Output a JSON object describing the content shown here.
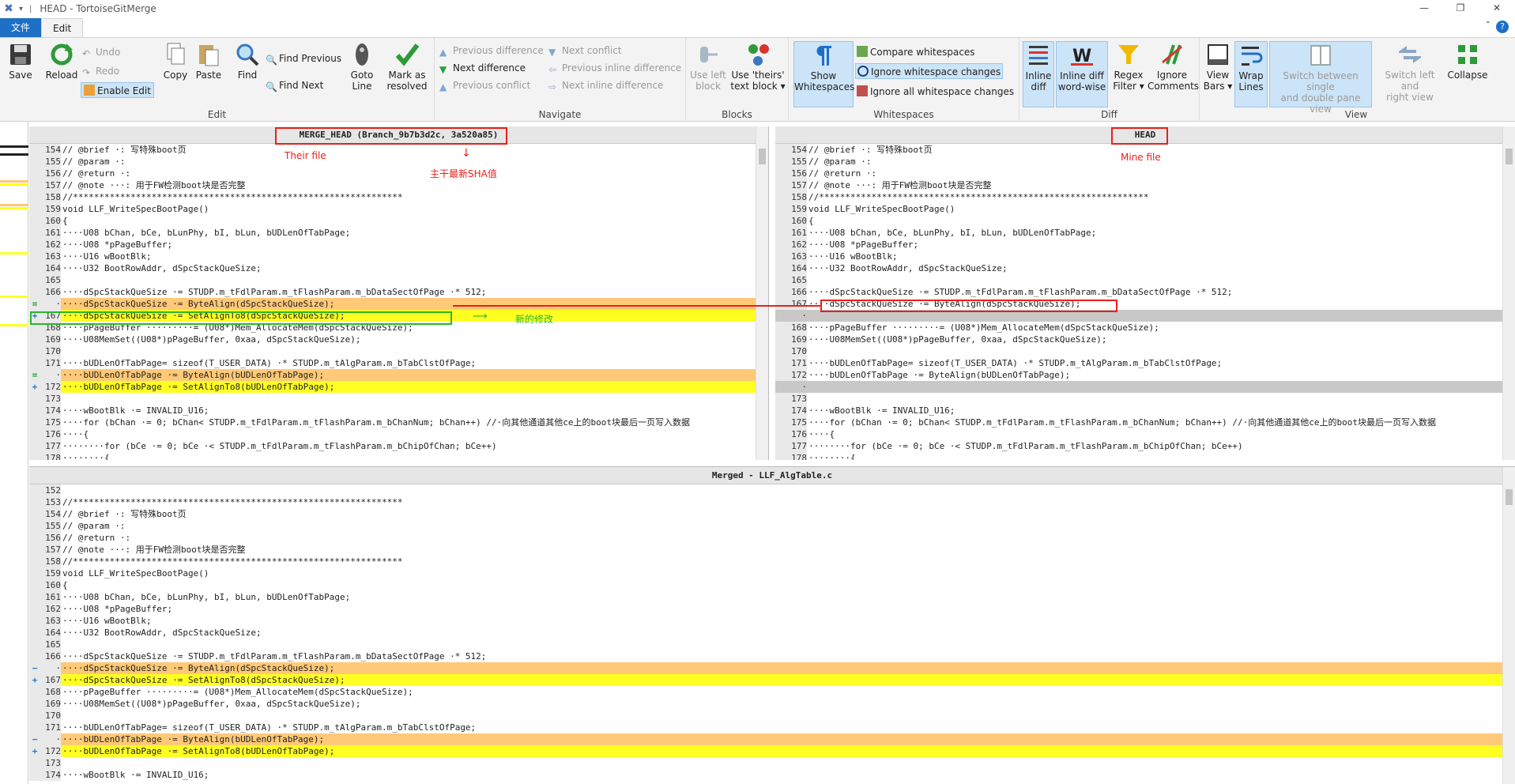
{
  "window": {
    "title": "HEAD - TortoiseGitMerge",
    "min": "—",
    "max": "❐",
    "close": "✕"
  },
  "ribbon_tabs": {
    "file": "文件",
    "edit": "Edit"
  },
  "ribbon": {
    "edit_group": {
      "label": "Edit",
      "save": "Save",
      "reload": "Reload",
      "undo": "Undo",
      "redo": "Redo",
      "enable_edit": "Enable Edit",
      "copy": "Copy",
      "paste": "Paste",
      "find": "Find",
      "find_previous": "Find Previous",
      "find_next": "Find Next",
      "goto_line_1": "Goto",
      "goto_line_2": "Line",
      "mark_resolved_1": "Mark as",
      "mark_resolved_2": "resolved"
    },
    "navigate_group": {
      "label": "Navigate",
      "prev_diff": "Previous difference",
      "next_diff": "Next difference",
      "prev_conflict": "Previous conflict",
      "next_conflict": "Next conflict",
      "prev_inline": "Previous inline difference",
      "next_inline": "Next inline difference"
    },
    "blocks_group": {
      "label": "Blocks",
      "use_left_1": "Use left",
      "use_left_2": "block",
      "use_theirs_1": "Use 'theirs'",
      "use_theirs_2": "text block"
    },
    "whitespaces_group": {
      "label": "Whitespaces",
      "show_ws_1": "Show",
      "show_ws_2": "Whitespaces",
      "compare_ws": "Compare whitespaces",
      "ignore_ws_changes": "Ignore whitespace changes",
      "ignore_all_ws": "Ignore all whitespace changes"
    },
    "diff_group": {
      "label": "Diff",
      "inline_diff_1": "Inline",
      "inline_diff_2": "diff",
      "inline_word_1": "Inline diff",
      "inline_word_2": "word-wise",
      "regex_1": "Regex",
      "regex_2": "Filter",
      "ignore_comments_1": "Ignore",
      "ignore_comments_2": "Comments"
    },
    "view_group": {
      "label": "View",
      "view_bars_1": "View",
      "view_bars_2": "Bars",
      "wrap_1": "Wrap",
      "wrap_2": "Lines",
      "switch_pane_1": "Switch between single",
      "switch_pane_2": "and double pane view",
      "switch_lr_1": "Switch left and",
      "switch_lr_2": "right view",
      "collapse": "Collapse"
    }
  },
  "left_pane": {
    "header": "MERGE_HEAD (Branch_9b7b3d2c, 3a520a85)",
    "lines": [
      {
        "n": "154",
        "t": "// @brief ·: 写特殊boot页",
        "k": ""
      },
      {
        "n": "155",
        "t": "// @param ·:",
        "k": ""
      },
      {
        "n": "156",
        "t": "// @return ·:",
        "k": ""
      },
      {
        "n": "157",
        "t": "// @note ···: 用于FW检测boot块是否完整",
        "k": ""
      },
      {
        "n": "158",
        "t": "//***************************************************************",
        "k": ""
      },
      {
        "n": "159",
        "t": "void LLF_WriteSpecBootPage()",
        "k": ""
      },
      {
        "n": "160",
        "t": "{",
        "k": ""
      },
      {
        "n": "161",
        "t": "····U08 bChan, bCe, bLunPhy, bI, bLun, bUDLenOfTabPage;",
        "k": ""
      },
      {
        "n": "162",
        "t": "····U08 *pPageBuffer;",
        "k": ""
      },
      {
        "n": "163",
        "t": "····U16 wBootBlk;",
        "k": ""
      },
      {
        "n": "164",
        "t": "····U32 BootRowAddr, dSpcStackQueSize;",
        "k": ""
      },
      {
        "n": "165",
        "t": "",
        "k": ""
      },
      {
        "n": "166",
        "t": "····dSpcStackQueSize ·= STUDP.m_tFdlParam.m_tFlashParam.m_bDataSectOfPage ·* 512;",
        "k": ""
      },
      {
        "n": "·",
        "t": "····dSpcStackQueSize ·= ByteAlign(dSpcStackQueSize);",
        "k": "orange",
        "m": "="
      },
      {
        "n": "167",
        "t": "····dSpcStackQueSize ·= SetAlignTo8(dSpcStackQueSize);",
        "k": "yellow",
        "m": "+"
      },
      {
        "n": "168",
        "t": "····pPageBuffer ·········= (U08*)Mem_AllocateMem(dSpcStackQueSize);",
        "k": ""
      },
      {
        "n": "169",
        "t": "····U08MemSet((U08*)pPageBuffer, 0xaa, dSpcStackQueSize);",
        "k": ""
      },
      {
        "n": "170",
        "t": "",
        "k": ""
      },
      {
        "n": "171",
        "t": "····bUDLenOfTabPage= sizeof(T_USER_DATA) ·* STUDP.m_tAlgParam.m_bTabClstOfPage;",
        "k": ""
      },
      {
        "n": "·",
        "t": "····bUDLenOfTabPage ·= ByteAlign(bUDLenOfTabPage);",
        "k": "orange",
        "m": "="
      },
      {
        "n": "172",
        "t": "····bUDLenOfTabPage ·= SetAlignTo8(bUDLenOfTabPage);",
        "k": "yellow",
        "m": "+"
      },
      {
        "n": "173",
        "t": "",
        "k": ""
      },
      {
        "n": "174",
        "t": "····wBootBlk ·= INVALID_U16;",
        "k": ""
      },
      {
        "n": "175",
        "t": "····for (bChan ·= 0; bChan< STUDP.m_tFdlParam.m_tFlashParam.m_bChanNum; bChan++) //·向其他通道其他ce上的boot块最后一页写入数据",
        "k": ""
      },
      {
        "n": "176",
        "t": "····{",
        "k": ""
      },
      {
        "n": "177",
        "t": "········for (bCe ·= 0; bCe ·< STUDP.m_tFdlParam.m_tFlashParam.m_bChipOfChan; bCe++)",
        "k": ""
      },
      {
        "n": "178",
        "t": "········{",
        "k": ""
      }
    ]
  },
  "right_pane": {
    "header": "HEAD",
    "lines": [
      {
        "n": "154",
        "t": "// @brief ·: 写特殊boot页",
        "k": ""
      },
      {
        "n": "155",
        "t": "// @param ·:",
        "k": ""
      },
      {
        "n": "156",
        "t": "// @return ·:",
        "k": ""
      },
      {
        "n": "157",
        "t": "// @note ···: 用于FW检测boot块是否完整",
        "k": ""
      },
      {
        "n": "158",
        "t": "//***************************************************************",
        "k": ""
      },
      {
        "n": "159",
        "t": "void LLF_WriteSpecBootPage()",
        "k": ""
      },
      {
        "n": "160",
        "t": "{",
        "k": ""
      },
      {
        "n": "161",
        "t": "····U08 bChan, bCe, bLunPhy, bI, bLun, bUDLenOfTabPage;",
        "k": ""
      },
      {
        "n": "162",
        "t": "····U08 *pPageBuffer;",
        "k": ""
      },
      {
        "n": "163",
        "t": "····U16 wBootBlk;",
        "k": ""
      },
      {
        "n": "164",
        "t": "····U32 BootRowAddr, dSpcStackQueSize;",
        "k": ""
      },
      {
        "n": "165",
        "t": "",
        "k": ""
      },
      {
        "n": "166",
        "t": "····dSpcStackQueSize ·= STUDP.m_tFdlParam.m_tFlashParam.m_bDataSectOfPage ·* 512;",
        "k": ""
      },
      {
        "n": "167",
        "t": "····dSpcStackQueSize ·= ByteAlign(dSpcStackQueSize);",
        "k": ""
      },
      {
        "n": "·",
        "t": "",
        "k": "gray"
      },
      {
        "n": "168",
        "t": "····pPageBuffer ·········= (U08*)Mem_AllocateMem(dSpcStackQueSize);",
        "k": ""
      },
      {
        "n": "169",
        "t": "····U08MemSet((U08*)pPageBuffer, 0xaa, dSpcStackQueSize);",
        "k": ""
      },
      {
        "n": "170",
        "t": "",
        "k": ""
      },
      {
        "n": "171",
        "t": "····bUDLenOfTabPage= sizeof(T_USER_DATA) ·* STUDP.m_tAlgParam.m_bTabClstOfPage;",
        "k": ""
      },
      {
        "n": "172",
        "t": "····bUDLenOfTabPage ·= ByteAlign(bUDLenOfTabPage);",
        "k": ""
      },
      {
        "n": "·",
        "t": "",
        "k": "gray"
      },
      {
        "n": "173",
        "t": "",
        "k": ""
      },
      {
        "n": "174",
        "t": "····wBootBlk ·= INVALID_U16;",
        "k": ""
      },
      {
        "n": "175",
        "t": "····for (bChan ·= 0; bChan< STUDP.m_tFdlParam.m_tFlashParam.m_bChanNum; bChan++) //·向其他通道其他ce上的boot块最后一页写入数据",
        "k": ""
      },
      {
        "n": "176",
        "t": "····{",
        "k": ""
      },
      {
        "n": "177",
        "t": "········for (bCe ·= 0; bCe ·< STUDP.m_tFdlParam.m_tFlashParam.m_bChipOfChan; bCe++)",
        "k": ""
      },
      {
        "n": "178",
        "t": "········{",
        "k": ""
      }
    ]
  },
  "bottom_pane": {
    "header": "Merged - LLF_AlgTable.c",
    "lines": [
      {
        "n": "152",
        "t": "",
        "k": ""
      },
      {
        "n": "153",
        "t": "//***************************************************************",
        "k": ""
      },
      {
        "n": "154",
        "t": "// @brief ·: 写特殊boot页",
        "k": ""
      },
      {
        "n": "155",
        "t": "// @param ·:",
        "k": ""
      },
      {
        "n": "156",
        "t": "// @return ·:",
        "k": ""
      },
      {
        "n": "157",
        "t": "// @note ···: 用于FW检测boot块是否完整",
        "k": ""
      },
      {
        "n": "158",
        "t": "//***************************************************************",
        "k": ""
      },
      {
        "n": "159",
        "t": "void LLF_WriteSpecBootPage()",
        "k": ""
      },
      {
        "n": "160",
        "t": "{",
        "k": ""
      },
      {
        "n": "161",
        "t": "····U08 bChan, bCe, bLunPhy, bI, bLun, bUDLenOfTabPage;",
        "k": ""
      },
      {
        "n": "162",
        "t": "····U08 *pPageBuffer;",
        "k": ""
      },
      {
        "n": "163",
        "t": "····U16 wBootBlk;",
        "k": ""
      },
      {
        "n": "164",
        "t": "····U32 BootRowAddr, dSpcStackQueSize;",
        "k": ""
      },
      {
        "n": "165",
        "t": "",
        "k": ""
      },
      {
        "n": "166",
        "t": "····dSpcStackQueSize ·= STUDP.m_tFdlParam.m_tFlashParam.m_bDataSectOfPage ·* 512;",
        "k": ""
      },
      {
        "n": "·",
        "t": "····dSpcStackQueSize ·= ByteAlign(dSpcStackQueSize);",
        "k": "orange",
        "m": "−"
      },
      {
        "n": "167",
        "t": "····dSpcStackQueSize ·= SetAlignTo8(dSpcStackQueSize);",
        "k": "yellow",
        "m": "+"
      },
      {
        "n": "168",
        "t": "····pPageBuffer ·········= (U08*)Mem_AllocateMem(dSpcStackQueSize);",
        "k": ""
      },
      {
        "n": "169",
        "t": "····U08MemSet((U08*)pPageBuffer, 0xaa, dSpcStackQueSize);",
        "k": ""
      },
      {
        "n": "170",
        "t": "",
        "k": ""
      },
      {
        "n": "171",
        "t": "····bUDLenOfTabPage= sizeof(T_USER_DATA) ·* STUDP.m_tAlgParam.m_bTabClstOfPage;",
        "k": ""
      },
      {
        "n": "·",
        "t": "····bUDLenOfTabPage ·= ByteAlign(bUDLenOfTabPage);",
        "k": "orange",
        "m": "−"
      },
      {
        "n": "172",
        "t": "····bUDLenOfTabPage ·= SetAlignTo8(bUDLenOfTabPage);",
        "k": "yellow",
        "m": "+"
      },
      {
        "n": "173",
        "t": "",
        "k": ""
      },
      {
        "n": "174",
        "t": "····wBootBlk ·= INVALID_U16;",
        "k": ""
      }
    ]
  },
  "annotations": {
    "their_file": "Their file",
    "sha_note": "主干最新SHA值",
    "mine_file": "Mine file",
    "new_change": "新的修改"
  },
  "colors": {
    "orange": "#ffc977",
    "yellow": "#ffff22",
    "accent": "#1e6fc6",
    "annotation_red": "#e8201a",
    "annotation_green": "#2ab52a"
  }
}
